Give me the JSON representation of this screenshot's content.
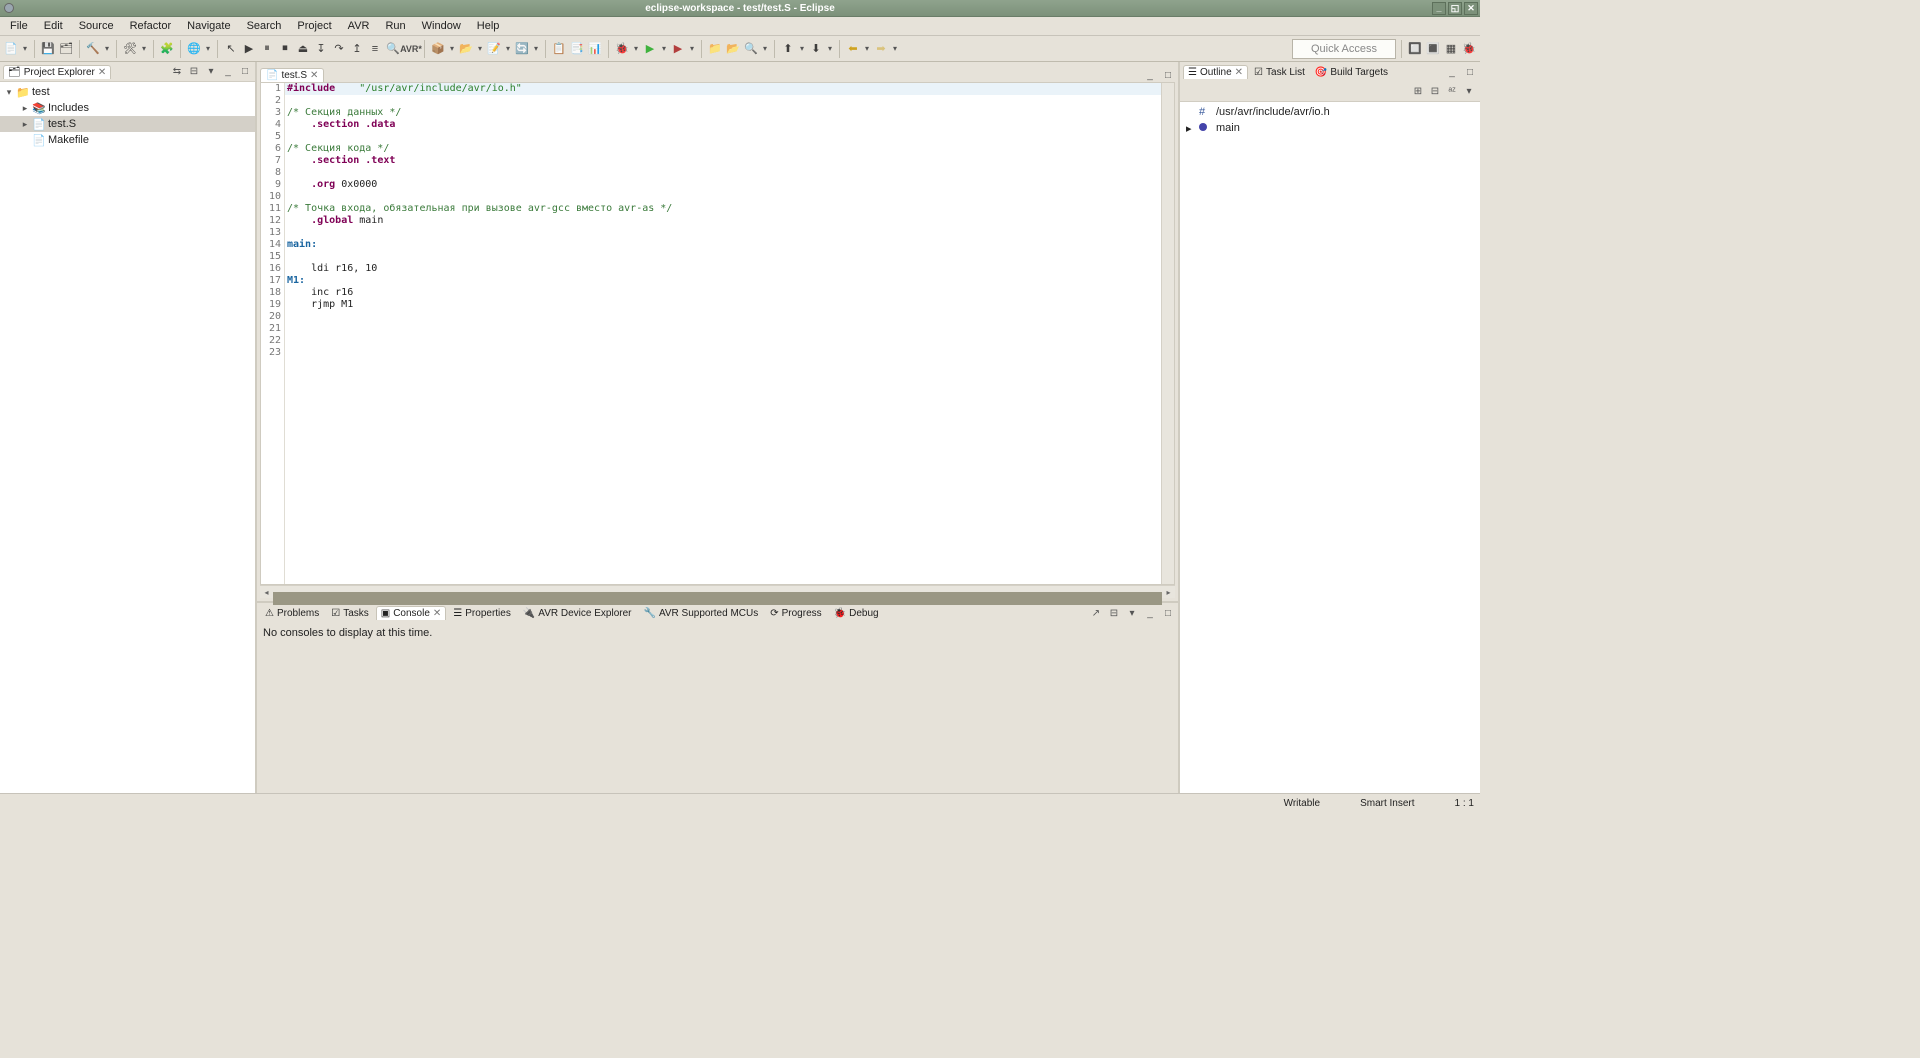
{
  "window": {
    "title": "eclipse-workspace - test/test.S - Eclipse"
  },
  "menu": [
    "File",
    "Edit",
    "Source",
    "Refactor",
    "Navigate",
    "Search",
    "Project",
    "AVR",
    "Run",
    "Window",
    "Help"
  ],
  "quick_access": "Quick Access",
  "project_explorer": {
    "title": "Project Explorer",
    "items": [
      {
        "indent": 0,
        "exp": true,
        "icon": "folder",
        "label": "test"
      },
      {
        "indent": 1,
        "exp": false,
        "icon": "inc",
        "label": "Includes"
      },
      {
        "indent": 1,
        "exp": false,
        "icon": "file",
        "label": "test.S",
        "selected": true
      },
      {
        "indent": 1,
        "exp": null,
        "icon": "file",
        "label": "Makefile"
      }
    ]
  },
  "editor": {
    "tab": "test.S",
    "lines": [
      {
        "n": 1,
        "hl": true,
        "segs": [
          {
            "t": "#include",
            "c": "kw-pp"
          },
          {
            "t": "    "
          },
          {
            "t": "\"/usr/avr/include/avr/io.h\"",
            "c": "str"
          }
        ]
      },
      {
        "n": 2,
        "segs": []
      },
      {
        "n": 3,
        "segs": [
          {
            "t": "/* Секция данных */",
            "c": "cmt"
          }
        ]
      },
      {
        "n": 4,
        "segs": [
          {
            "t": "    "
          },
          {
            "t": ".section .data",
            "c": "kw-dir"
          }
        ]
      },
      {
        "n": 5,
        "segs": []
      },
      {
        "n": 6,
        "segs": [
          {
            "t": "/* Секция кода */",
            "c": "cmt"
          }
        ]
      },
      {
        "n": 7,
        "segs": [
          {
            "t": "    "
          },
          {
            "t": ".section .text",
            "c": "kw-dir"
          }
        ]
      },
      {
        "n": 8,
        "segs": []
      },
      {
        "n": 9,
        "segs": [
          {
            "t": "    "
          },
          {
            "t": ".org",
            "c": "kw-dir"
          },
          {
            "t": " 0x0000"
          }
        ]
      },
      {
        "n": 10,
        "segs": []
      },
      {
        "n": 11,
        "segs": [
          {
            "t": "/* Точка входа, обязательная при вызове avr-gcc вместо avr-as */",
            "c": "cmt"
          }
        ]
      },
      {
        "n": 12,
        "segs": [
          {
            "t": "    "
          },
          {
            "t": ".global",
            "c": "kw-dir"
          },
          {
            "t": " main"
          }
        ]
      },
      {
        "n": 13,
        "segs": []
      },
      {
        "n": 14,
        "segs": [
          {
            "t": "main:",
            "c": "lbl"
          }
        ]
      },
      {
        "n": 15,
        "segs": []
      },
      {
        "n": 16,
        "segs": [
          {
            "t": "    ldi r16, 10"
          }
        ]
      },
      {
        "n": 17,
        "segs": [
          {
            "t": "M1:",
            "c": "lbl"
          }
        ]
      },
      {
        "n": 18,
        "segs": [
          {
            "t": "    inc r16"
          }
        ]
      },
      {
        "n": 19,
        "segs": [
          {
            "t": "    rjmp M1"
          }
        ]
      },
      {
        "n": 20,
        "segs": []
      },
      {
        "n": 21,
        "segs": []
      },
      {
        "n": 22,
        "segs": []
      },
      {
        "n": 23,
        "segs": []
      }
    ]
  },
  "outline": {
    "title": "Outline",
    "other_tabs": [
      "Task List",
      "Build Targets"
    ],
    "items": [
      {
        "icon": "inc",
        "label": "/usr/avr/include/avr/io.h"
      },
      {
        "icon": "dot",
        "label": "main",
        "exp": true
      }
    ]
  },
  "bottom": {
    "tabs": [
      "Problems",
      "Tasks",
      "Console",
      "Properties",
      "AVR Device Explorer",
      "AVR Supported MCUs",
      "Progress",
      "Debug"
    ],
    "active": "Console",
    "body": "No consoles to display at this time."
  },
  "status": {
    "writable": "Writable",
    "insert": "Smart Insert",
    "pos": "1 : 1"
  },
  "icons": {
    "close": "✕",
    "min": "_",
    "max": "□",
    "restore": "◱"
  }
}
